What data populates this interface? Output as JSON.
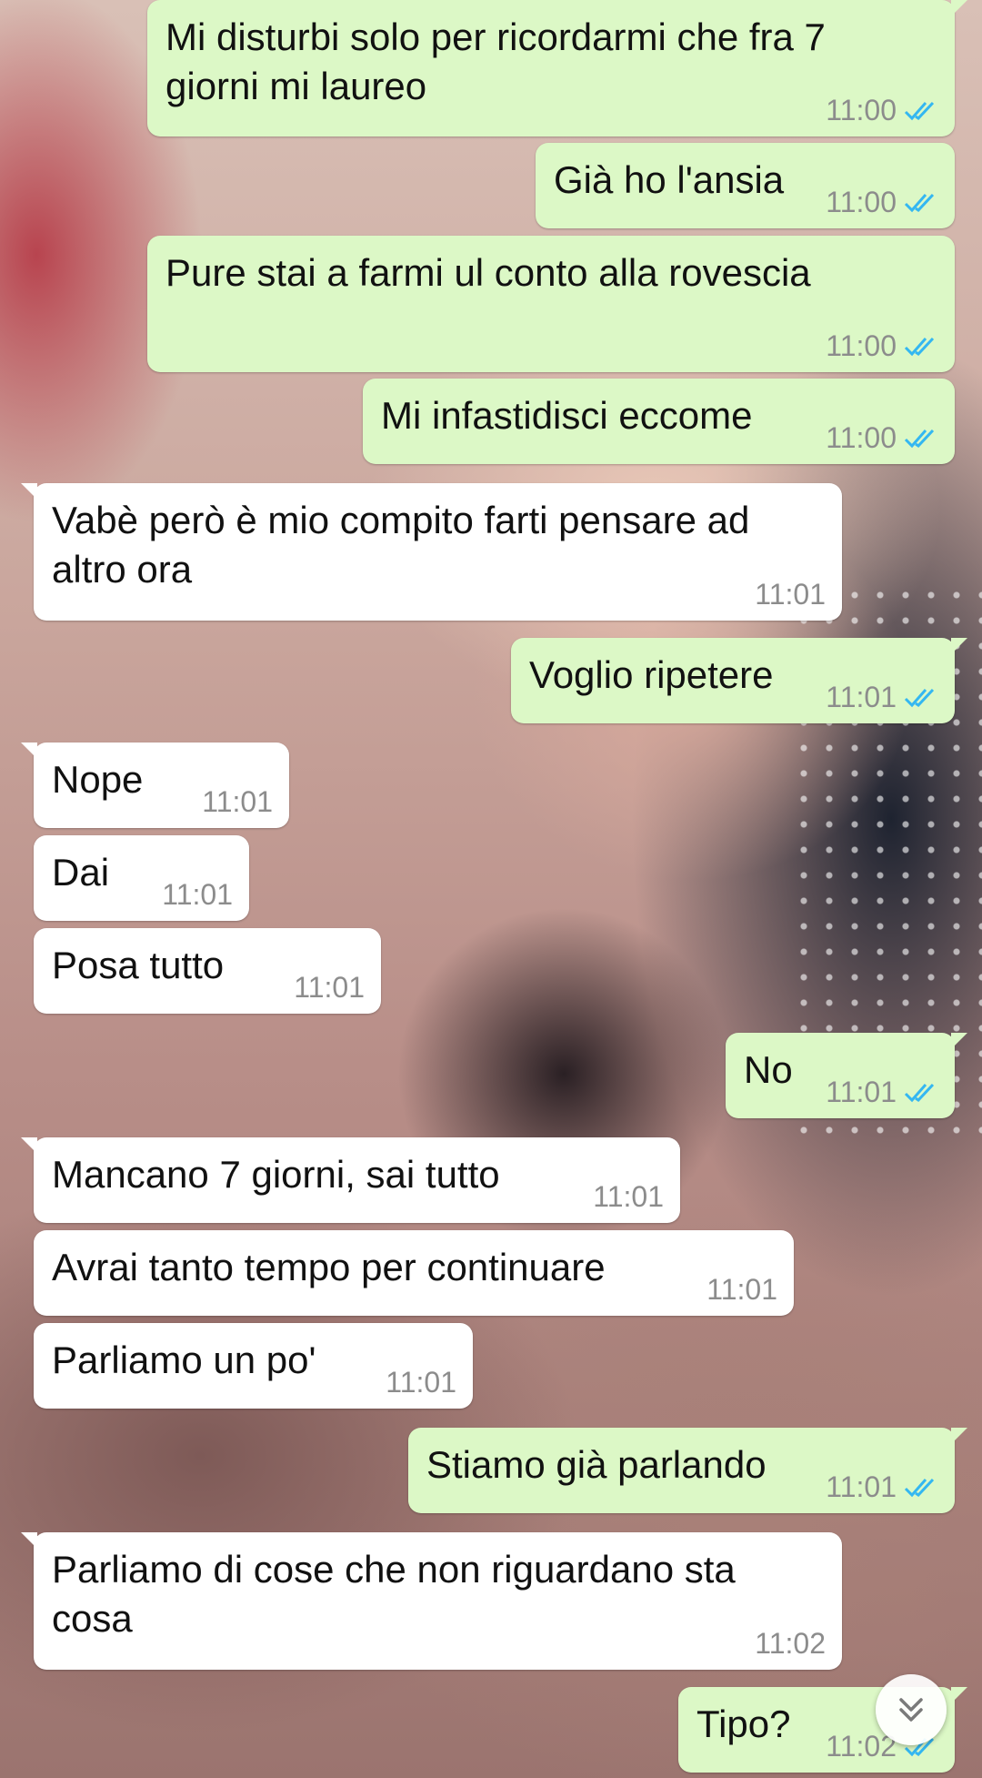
{
  "messages": [
    {
      "dir": "out",
      "text": "Mi disturbi solo per ricordarmi che fra 7\ngiorni mi laureo",
      "time": "11:00",
      "read": true
    },
    {
      "dir": "out",
      "text": "Già ho l'ansia",
      "time": "11:00",
      "read": true
    },
    {
      "dir": "out",
      "text": "Pure stai a farmi ul conto alla rovescia",
      "time": "11:00",
      "read": true
    },
    {
      "dir": "out",
      "text": "Mi infastidisci eccome",
      "time": "11:00",
      "read": true
    },
    {
      "dir": "in",
      "text": "Vabè però è mio compito farti pensare ad\naltro ora",
      "time": "11:01"
    },
    {
      "dir": "out",
      "text": "Voglio ripetere",
      "time": "11:01",
      "read": true
    },
    {
      "dir": "in",
      "text": "Nope",
      "time": "11:01"
    },
    {
      "dir": "in",
      "text": "Dai",
      "time": "11:01"
    },
    {
      "dir": "in",
      "text": "Posa tutto",
      "time": "11:01"
    },
    {
      "dir": "out",
      "text": "No",
      "time": "11:01",
      "read": true
    },
    {
      "dir": "in",
      "text": "Mancano 7 giorni, sai tutto",
      "time": "11:01"
    },
    {
      "dir": "in",
      "text": "Avrai tanto tempo per continuare",
      "time": "11:01"
    },
    {
      "dir": "in",
      "text": "Parliamo un po'",
      "time": "11:01"
    },
    {
      "dir": "out",
      "text": "Stiamo già parlando",
      "time": "11:01",
      "read": true
    },
    {
      "dir": "in",
      "text": "Parliamo di cose che non riguardano sta\ncosa",
      "time": "11:02"
    },
    {
      "dir": "out",
      "text": "Tipo?",
      "time": "11:02",
      "read": true
    }
  ],
  "colors": {
    "outgoing_bubble": "#dcf8c6",
    "incoming_bubble": "#ffffff",
    "read_ticks": "#34b7f1",
    "timestamp": "#8c8c8c"
  },
  "scroll_button_icon": "double-chevron-down-icon"
}
